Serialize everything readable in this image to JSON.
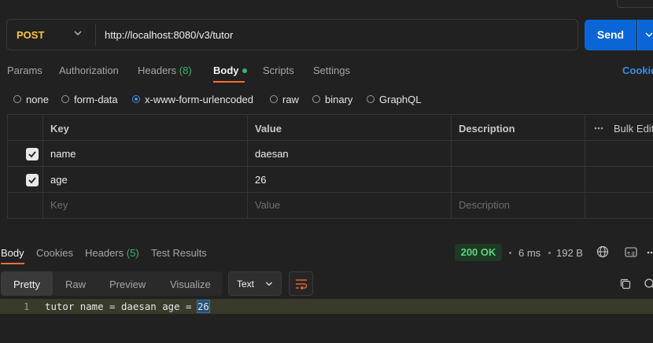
{
  "request": {
    "method": "POST",
    "url": "http://localhost:8080/v3/tutor",
    "send_label": "Send"
  },
  "request_tabs": [
    {
      "label": "Params"
    },
    {
      "label": "Authorization"
    },
    {
      "label": "Headers",
      "count": "(8)"
    },
    {
      "label": "Body",
      "active": true
    },
    {
      "label": "Scripts"
    },
    {
      "label": "Settings"
    }
  ],
  "cookies_label": "Cookie",
  "body_types": [
    {
      "label": "none"
    },
    {
      "label": "form-data"
    },
    {
      "label": "x-www-form-urlencoded",
      "selected": true
    },
    {
      "label": "raw"
    },
    {
      "label": "binary"
    },
    {
      "label": "GraphQL"
    }
  ],
  "params_table": {
    "headers": [
      "Key",
      "Value",
      "Description",
      "Bulk Edit"
    ],
    "rows": [
      {
        "checked": true,
        "key": "name",
        "value": "daesan",
        "description": ""
      },
      {
        "checked": true,
        "key": "age",
        "value": "26",
        "description": ""
      }
    ],
    "placeholder": {
      "key": "Key",
      "value": "Value",
      "description": "Description"
    }
  },
  "response": {
    "tabs": [
      {
        "label": "Body",
        "active": true
      },
      {
        "label": "Cookies"
      },
      {
        "label": "Headers",
        "count": "(5)"
      },
      {
        "label": "Test Results"
      }
    ],
    "status": "200 OK",
    "time": "6 ms",
    "size": "192 B",
    "view_modes": [
      "Pretty",
      "Raw",
      "Preview",
      "Visualize"
    ],
    "format": "Text",
    "line_number": "1",
    "code_prefix": "tutor name = daesan age = ",
    "code_selected": "26"
  },
  "colors": {
    "method": "#ffc43d",
    "send": "#0a66d6",
    "accent_tab": "#ff6c37",
    "success": "#5fd27c",
    "link": "#3a8ce6"
  }
}
